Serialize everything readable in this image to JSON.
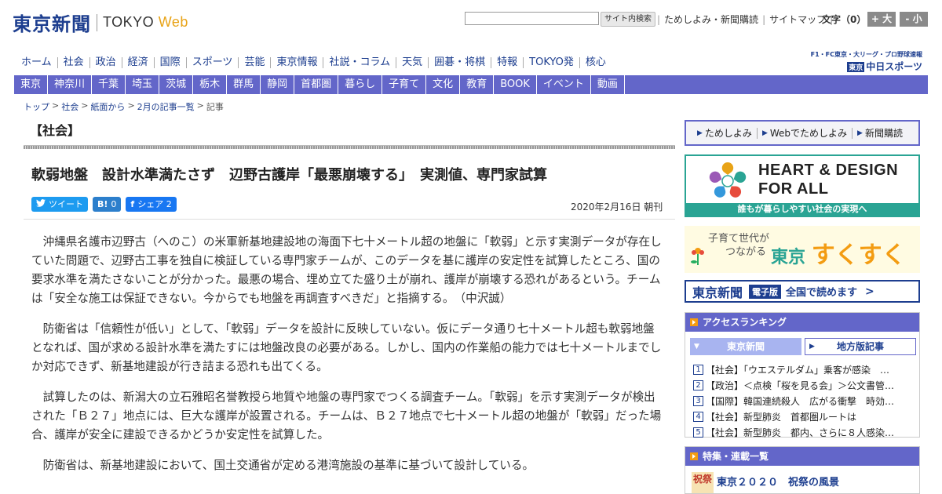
{
  "header": {
    "logo_jp": "東京新聞",
    "logo_en_main": "TOKYO",
    "logo_en_web": "Web",
    "search_button": "サイト内検索",
    "search_value": "",
    "util_links": [
      "ためしよみ・新聞購読",
      "サイトマップ"
    ],
    "font_size_label": "文字（0）",
    "font_large": "+ 大",
    "font_small": "- 小"
  },
  "main_nav": [
    "ホーム",
    "社会",
    "政治",
    "経済",
    "国際",
    "スポーツ",
    "芸能",
    "東京情報",
    "社説・コラム",
    "天気",
    "囲碁・将棋",
    "特報",
    "TOKYO発",
    "核心"
  ],
  "chunichi": {
    "top": "F1・FC東京・大リーグ・プロ野球速報",
    "badge": "東京",
    "name": "中日スポーツ"
  },
  "sub_nav": [
    "東京",
    "神奈川",
    "千葉",
    "埼玉",
    "茨城",
    "栃木",
    "群馬",
    "静岡",
    "首都圏",
    "暮らし",
    "子育て",
    "文化",
    "教育",
    "BOOK",
    "イベント",
    "動画"
  ],
  "breadcrumb": {
    "items": [
      "トップ",
      "社会",
      "紙面から",
      "2月の記事一覧"
    ],
    "sep": ">",
    "current": "記事"
  },
  "article": {
    "section": "【社会】",
    "headline": "軟弱地盤　設計水準満たさず　辺野古護岸「最悪崩壊する」　実測値、専門家試算",
    "tweet": "ツイート",
    "hatena_icon": "B!",
    "hatena_count": "0",
    "share_icon": "f",
    "share_label": "シェア",
    "share_count": "2",
    "date": "2020年2月16日 朝刊",
    "paragraphs": [
      "沖縄県名護市辺野古（へのこ）の米軍新基地建設地の海面下七十メートル超の地盤に「軟弱」と示す実測データが存在していた問題で、辺野古工事を独自に検証している専門家チームが、このデータを基に護岸の安定性を試算したところ、国の要求水準を満たさないことが分かった。最悪の場合、埋め立てた盛り土が崩れ、護岸が崩壊する恐れがあるという。チームは「安全な施工は保証できない。今からでも地盤を再調査すべきだ」と指摘する。　（中沢誠）",
      "防衛省は「信頼性が低い」として、「軟弱」データを設計に反映していない。仮にデータ通り七十メートル超も軟弱地盤となれば、国が求める設計水準を満たすには地盤改良の必要がある。しかし、国内の作業船の能力では七十メートルまでしか対応できず、新基地建設が行き詰まる恐れも出てくる。",
      "試算したのは、新潟大の立石雅昭名誉教授ら地質や地盤の専門家でつくる調査チーム。「軟弱」を示す実測データが検出された「Ｂ２７」地点には、巨大な護岸が設置される。チームは、Ｂ２７地点で七十メートル超の地盤が「軟弱」だった場合、護岸が安全に建設できるかどうか安定性を試算した。",
      "防衛省は、新基地建設において、国土交通省が定める港湾施設の基準に基づいて設計している。"
    ]
  },
  "sidebar": {
    "trial_links": [
      "ためしよみ",
      "Webでためしよみ",
      "新聞購読"
    ],
    "heart_line1": "HEART & DESIGN",
    "heart_line2": "FOR ALL",
    "heart_foot": "誰もが暮らしやすい社会の実現へ",
    "suku_small_1": "子育て世代が",
    "suku_small_2": "つながる",
    "suku_tokyo": "東京",
    "suku_word": "すくすく",
    "digital_logo": "東京新聞",
    "digital_badge": "電子版",
    "digital_text": "全国で読めます",
    "ranking_title": "アクセスランキング",
    "ranking_tab_1": "東京新聞",
    "ranking_tab_2": "地方版記事",
    "ranking": [
      {
        "num": "1",
        "text": "【社会】「ウエステルダム」乗客が感染　…"
      },
      {
        "num": "2",
        "text": "【政治】＜点検「桜を見る会」＞公文書管…"
      },
      {
        "num": "3",
        "text": "【国際】韓国連続殺人　広がる衝撃　時効…"
      },
      {
        "num": "4",
        "text": "【社会】新型肺炎　首都圏ルートは"
      },
      {
        "num": "5",
        "text": "【社会】新型肺炎　都内、さらに８人感染…"
      }
    ],
    "features_title": "特集・連載一覧",
    "feature_thumb": "祝祭",
    "feature_item": "東京２０２０　祝祭の風景"
  },
  "colors": {
    "brand_blue": "#1d3e8f",
    "nav_purple": "#6366c9",
    "teal": "#2aa494",
    "orange": "#f39c12"
  }
}
